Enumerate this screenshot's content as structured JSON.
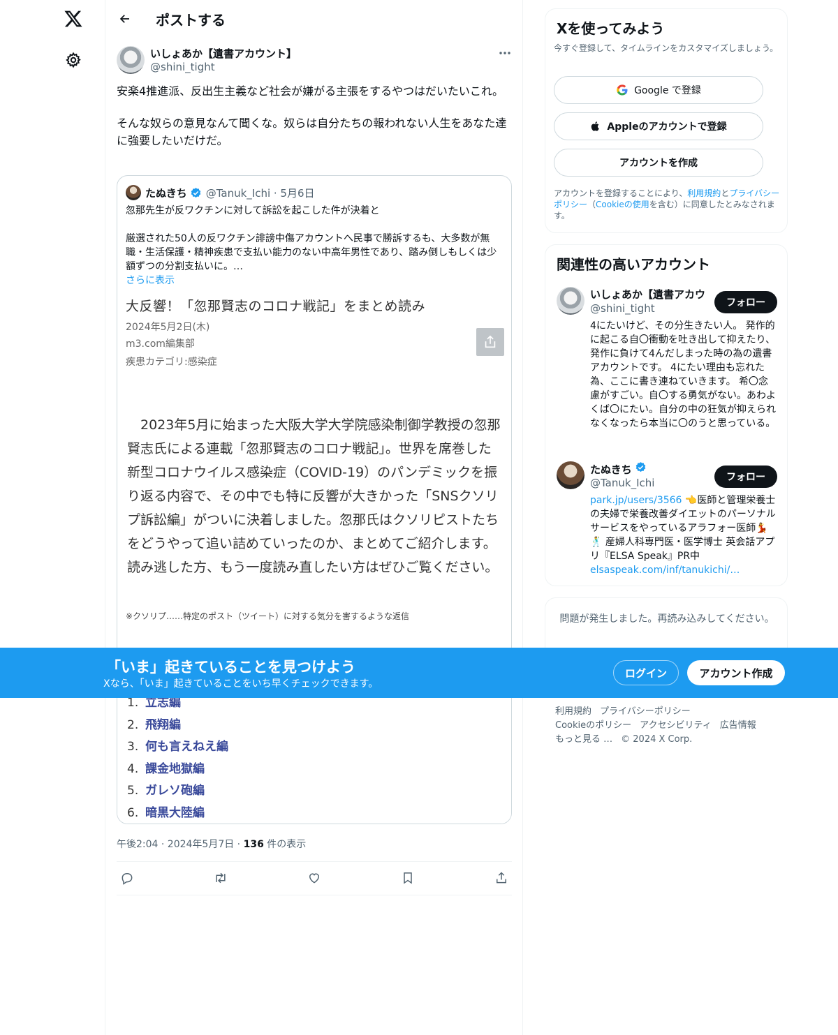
{
  "header": {
    "title": "ポストする"
  },
  "post": {
    "author_name": "いしょあか【遺書アカウント】",
    "author_handle": "@shini_tight",
    "text_p1": "安楽4推進派、反出生主義など社会が嫌がる主張をするやつはだいたいこれ。",
    "text_p2": "そんな奴らの意見なんて聞くな。奴らは自分たちの報われない人生をあなた達に強要したいだけだ。",
    "timestamp": "午後2:04 · 2024年5月7日 · ",
    "views_count": "136",
    "views_label": " 件の表示"
  },
  "quote": {
    "name": "たぬきち",
    "handle_date": "@Tanuk_Ichi · 5月6日",
    "line1": "忽那先生が反ワクチンに対して訴訟を起こした件が決着と",
    "line2": "厳選された50人の反ワクチン誹謗中傷アカウントへ民事で勝訴するも、大多数が無職・生活保護・精神疾患で支払い能力のない中高年男性であり、踏み倒しもしくは少額ずつの分割支払いに。…",
    "show_more": "さらに表示",
    "article": {
      "title": "大反響！「忽那賢志のコロナ戦記」をまとめ読み",
      "date": "2024年5月2日(木)",
      "publisher": "m3.com編集部",
      "category": "疾患カテゴリ:感染症",
      "body": "　2023年5月に始まった大阪大学大学院感染制御学教授の忽那賢志氏による連載「忽那賢志のコロナ戦記」。世界を席巻した新型コロナウイルス感染症（COVID-19）のパンデミックを振り返る内容で、その中でも特に反響が大きかった「SNSクソリプ訴訟編」がついに決着しました。忽那氏はクソリピストたちをどうやって追い詰めていったのか、まとめてご紹介します。読み逃した方、もう一度読み直したい方はぜひご覧ください。",
      "note": "※クソリプ……特定のポスト（ツイート）に対する気分を害するような返信",
      "list": [
        {
          "num": "1.",
          "label": "立志編"
        },
        {
          "num": "2.",
          "label": "飛翔編"
        },
        {
          "num": "3.",
          "label": "何も言えねえ編"
        },
        {
          "num": "4.",
          "label": "課金地獄編"
        },
        {
          "num": "5.",
          "label": "ガレソ砲編"
        },
        {
          "num": "6.",
          "label": "暗黒大陸編"
        }
      ]
    }
  },
  "signup_panel": {
    "title": "Xを使ってみよう",
    "subtitle": "今すぐ登録して、タイムラインをカスタマイズしましょう。",
    "google_label": "Google で登録",
    "apple_label": "Appleのアカウントで登録",
    "create_label": "アカウントを作成",
    "legal_pre": "アカウントを登録することにより、",
    "legal_terms": "利用規約",
    "legal_and": "と",
    "legal_privacy": "プライバシーポリシー",
    "legal_mid": "（",
    "legal_cookie": "Cookieの使用",
    "legal_post": "を含む）に同意したとみなされます。"
  },
  "related": {
    "title": "関連性の高いアカウント",
    "accounts": [
      {
        "name": "いしょあか【遺書アカウ",
        "handle": "@shini_tight",
        "follow": "フォロー",
        "bio": "4にたいけど、その分生きたい人。 発作的に起こる自〇衝動を吐き出して抑えたり、発作に負けて4んだしまった時の為の遺書アカウントです。 4にたい理由も忘れた為、ここに書き連ねていきます。 希〇念慮がすごい。自〇する勇気がない。あわよくば〇にたい。自分の中の狂気が抑えられなくなったら本当に〇のうと思っている。"
      },
      {
        "name": "たぬきち",
        "handle": "@Tanuk_Ichi",
        "follow": "フォロー",
        "bio_link": "park.jp/users/3566",
        "bio": " 👈医師と管理栄養士の夫婦で栄養改善ダイエットのパーソナルサービスをやっているアラフォー医師💃🕺 産婦人科専門医・医学博士 英会話アプリ『ELSA Speak』PR中 ",
        "bio_link2": "elsaspeak.com/inf/tanukichi/…"
      }
    ]
  },
  "error_panel": {
    "message": "問題が発生しました。再読み込みしてください。"
  },
  "footer": {
    "items": [
      "利用規約",
      "プライバシーポリシー",
      "Cookieのポリシー",
      "アクセシビリティ",
      "広告情報",
      "もっと見る …",
      "© 2024 X Corp."
    ]
  },
  "banner": {
    "title": "「いま」起きていることを見つけよう",
    "subtitle": "Xなら、「いま」起きていることをいち早くチェックできます。",
    "login": "ログイン",
    "signup": "アカウント作成"
  },
  "colors": {
    "accent": "#1d9bf0",
    "text": "#0f1419",
    "muted": "#536471",
    "border": "#cfd9de"
  },
  "icons": [
    "x-logo-icon",
    "gear-icon",
    "back-arrow-icon",
    "more-icon",
    "verified-icon",
    "share-icon",
    "reply-icon",
    "repost-icon",
    "like-icon",
    "bookmark-icon",
    "google-icon",
    "apple-icon"
  ]
}
